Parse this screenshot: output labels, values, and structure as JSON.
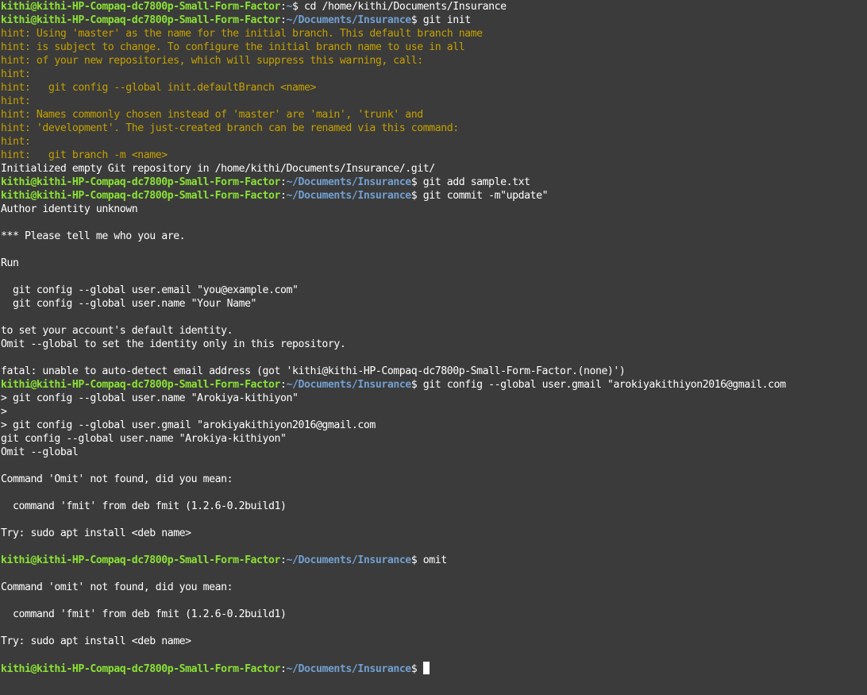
{
  "terminal": {
    "colors": {
      "background": "#3b3b3b",
      "foreground": "#ffffff",
      "prompt_user": "#8ae234",
      "prompt_path": "#729fcf",
      "hint": "#c4a000"
    },
    "lines": [
      {
        "kind": "prompt",
        "user": "kithi@kithi-HP-Compaq-dc7800p-Small-Form-Factor",
        "sep": ":",
        "path": "~",
        "end": "$ ",
        "cmd": "cd /home/kithi/Documents/Insurance"
      },
      {
        "kind": "prompt",
        "user": "kithi@kithi-HP-Compaq-dc7800p-Small-Form-Factor",
        "sep": ":",
        "path": "~/Documents/Insurance",
        "end": "$ ",
        "cmd": "git init"
      },
      {
        "kind": "hint",
        "text": "hint: Using 'master' as the name for the initial branch. This default branch name"
      },
      {
        "kind": "hint",
        "text": "hint: is subject to change. To configure the initial branch name to use in all"
      },
      {
        "kind": "hint",
        "text": "hint: of your new repositories, which will suppress this warning, call:"
      },
      {
        "kind": "hint",
        "text": "hint:"
      },
      {
        "kind": "hint",
        "text": "hint:   git config --global init.defaultBranch <name>"
      },
      {
        "kind": "hint",
        "text": "hint:"
      },
      {
        "kind": "hint",
        "text": "hint: Names commonly chosen instead of 'master' are 'main', 'trunk' and"
      },
      {
        "kind": "hint",
        "text": "hint: 'development'. The just-created branch can be renamed via this command:"
      },
      {
        "kind": "hint",
        "text": "hint:"
      },
      {
        "kind": "hint",
        "text": "hint:   git branch -m <name>"
      },
      {
        "kind": "output",
        "text": "Initialized empty Git repository in /home/kithi/Documents/Insurance/.git/"
      },
      {
        "kind": "prompt",
        "user": "kithi@kithi-HP-Compaq-dc7800p-Small-Form-Factor",
        "sep": ":",
        "path": "~/Documents/Insurance",
        "end": "$ ",
        "cmd": "git add sample.txt"
      },
      {
        "kind": "prompt",
        "user": "kithi@kithi-HP-Compaq-dc7800p-Small-Form-Factor",
        "sep": ":",
        "path": "~/Documents/Insurance",
        "end": "$ ",
        "cmd": "git commit -m\"update\""
      },
      {
        "kind": "output",
        "text": "Author identity unknown"
      },
      {
        "kind": "output",
        "text": ""
      },
      {
        "kind": "output",
        "text": "*** Please tell me who you are."
      },
      {
        "kind": "output",
        "text": ""
      },
      {
        "kind": "output",
        "text": "Run"
      },
      {
        "kind": "output",
        "text": ""
      },
      {
        "kind": "output",
        "text": "  git config --global user.email \"you@example.com\""
      },
      {
        "kind": "output",
        "text": "  git config --global user.name \"Your Name\""
      },
      {
        "kind": "output",
        "text": ""
      },
      {
        "kind": "output",
        "text": "to set your account's default identity."
      },
      {
        "kind": "output",
        "text": "Omit --global to set the identity only in this repository."
      },
      {
        "kind": "output",
        "text": ""
      },
      {
        "kind": "output",
        "text": "fatal: unable to auto-detect email address (got 'kithi@kithi-HP-Compaq-dc7800p-Small-Form-Factor.(none)')"
      },
      {
        "kind": "prompt",
        "user": "kithi@kithi-HP-Compaq-dc7800p-Small-Form-Factor",
        "sep": ":",
        "path": "~/Documents/Insurance",
        "end": "$ ",
        "cmd": "git config --global user.gmail \"arokiyakithiyon2016@gmail.com"
      },
      {
        "kind": "output",
        "text": "> git config --global user.name \"Arokiya-kithiyon\""
      },
      {
        "kind": "output",
        "text": ">"
      },
      {
        "kind": "output",
        "text": "> git config --global user.gmail \"arokiyakithiyon2016@gmail.com"
      },
      {
        "kind": "output",
        "text": "git config --global user.name \"Arokiya-kithiyon\""
      },
      {
        "kind": "output",
        "text": "Omit --global"
      },
      {
        "kind": "output",
        "text": ""
      },
      {
        "kind": "output",
        "text": "Command 'Omit' not found, did you mean:"
      },
      {
        "kind": "output",
        "text": ""
      },
      {
        "kind": "output",
        "text": "  command 'fmit' from deb fmit (1.2.6-0.2build1)"
      },
      {
        "kind": "output",
        "text": ""
      },
      {
        "kind": "output",
        "text": "Try: sudo apt install <deb name>"
      },
      {
        "kind": "output",
        "text": ""
      },
      {
        "kind": "prompt",
        "user": "kithi@kithi-HP-Compaq-dc7800p-Small-Form-Factor",
        "sep": ":",
        "path": "~/Documents/Insurance",
        "end": "$ ",
        "cmd": "omit"
      },
      {
        "kind": "output",
        "text": ""
      },
      {
        "kind": "output",
        "text": "Command 'omit' not found, did you mean:"
      },
      {
        "kind": "output",
        "text": ""
      },
      {
        "kind": "output",
        "text": "  command 'fmit' from deb fmit (1.2.6-0.2build1)"
      },
      {
        "kind": "output",
        "text": ""
      },
      {
        "kind": "output",
        "text": "Try: sudo apt install <deb name>"
      },
      {
        "kind": "output",
        "text": ""
      },
      {
        "kind": "prompt",
        "user": "kithi@kithi-HP-Compaq-dc7800p-Small-Form-Factor",
        "sep": ":",
        "path": "~/Documents/Insurance",
        "end": "$ ",
        "cmd": "",
        "cursor": true
      }
    ]
  }
}
